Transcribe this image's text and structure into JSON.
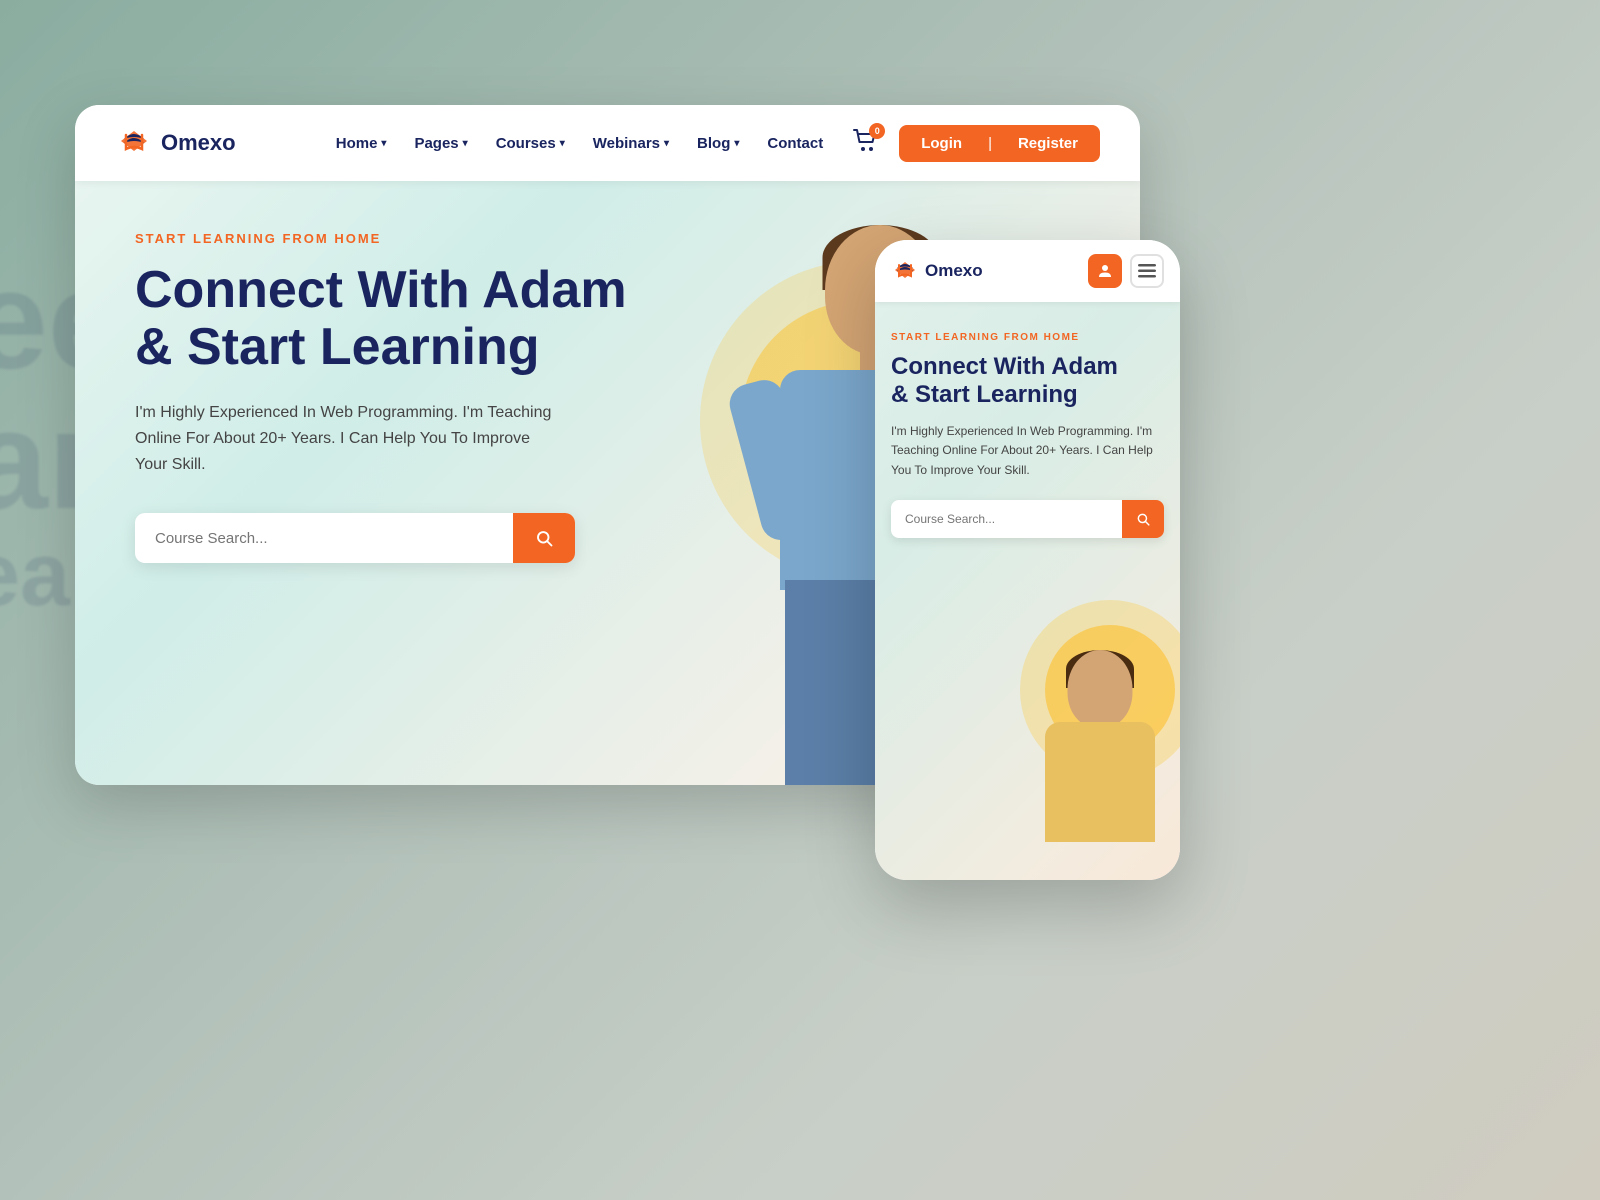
{
  "background": {
    "color": "#b5c5bc"
  },
  "desktop": {
    "nav": {
      "logo_text": "Omexo",
      "links": [
        {
          "label": "Home",
          "has_dropdown": true
        },
        {
          "label": "Pages",
          "has_dropdown": true
        },
        {
          "label": "Courses",
          "has_dropdown": true
        },
        {
          "label": "Webinars",
          "has_dropdown": true
        },
        {
          "label": "Blog",
          "has_dropdown": true
        },
        {
          "label": "Contact",
          "has_dropdown": false
        }
      ],
      "cart_count": "0",
      "login_label": "Login",
      "divider": "|",
      "register_label": "Register"
    },
    "hero": {
      "subtitle": "START LEARNING FROM HOME",
      "title_line1": "Connect With Adam",
      "title_line2": "& Start Learning",
      "description": "I'm Highly Experienced In Web Programming. I'm Teaching Online For About 20+ Years. I Can Help You To Improve Your Skill.",
      "search_placeholder": "Course Search..."
    }
  },
  "mobile": {
    "nav": {
      "logo_text": "Omexo"
    },
    "hero": {
      "subtitle": "START LEARNING FROM HOME",
      "title_line1": "Connect With Adam",
      "title_line2": "& Start Learning",
      "description": "I'm Highly Experienced In Web Programming. I'm Teaching Online For About 20+ Years. I Can Help You To Improve Your Skill.",
      "search_placeholder": "Course Search..."
    }
  },
  "bg_text": {
    "lines": [
      "ee",
      "art",
      "ears."
    ]
  }
}
